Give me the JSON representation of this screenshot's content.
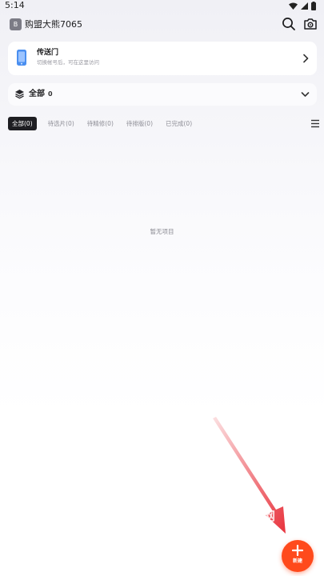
{
  "status_bar": {
    "time": "5:14",
    "icons": [
      "wifi-icon",
      "signal-icon",
      "battery-icon"
    ]
  },
  "header": {
    "avatar_text": "B",
    "title": "购盟大熊7065",
    "icons": [
      "search-icon",
      "camera-icon"
    ]
  },
  "portal": {
    "title": "传送门",
    "subtitle": "切换帐号后，可在这里访问",
    "icon": "phone-device-icon"
  },
  "filter": {
    "label": "全部",
    "count": "0",
    "icon": "layers-icon"
  },
  "tabs": [
    {
      "label": "全部(0)",
      "active": true
    },
    {
      "label": "待选片(0)",
      "active": false
    },
    {
      "label": "待精修(0)",
      "active": false
    },
    {
      "label": "待排版(0)",
      "active": false
    },
    {
      "label": "已完成(0)",
      "active": false
    }
  ],
  "empty_state": {
    "text": "暂无项目"
  },
  "fab": {
    "label": "新建",
    "icon": "plus-icon",
    "color": "#ff4a1c"
  },
  "watermark": {
    "text": "网"
  },
  "colors": {
    "accent": "#ff4a1c",
    "annotation_arrow": "#e8323c",
    "tab_active_bg": "#1e1e22"
  }
}
